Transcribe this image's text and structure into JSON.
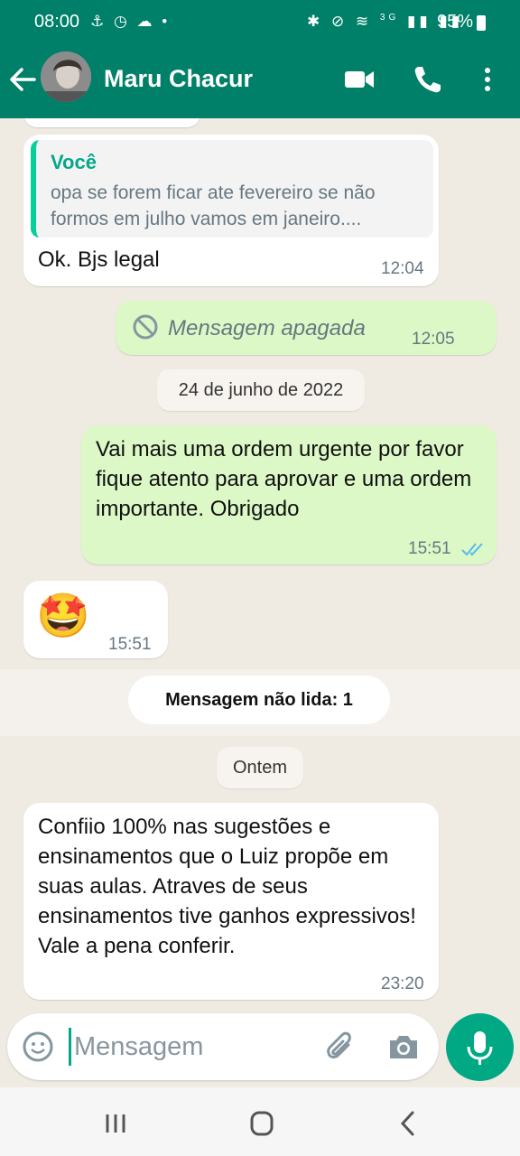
{
  "status": {
    "time": "08:00",
    "battery": "95%",
    "network": "3G"
  },
  "header": {
    "contact_name": "Maru Chacur"
  },
  "messages": [
    {
      "type": "incoming",
      "quote_author": "Você",
      "quote_text": "opa se forem ficar ate fevereiro se não formos em julho vamos em janeiro....",
      "text": "Ok. Bjs legal",
      "time": "12:04"
    },
    {
      "type": "outgoing",
      "text": "Mensagem apagada",
      "time": "12:05"
    },
    {
      "type": "outgoing",
      "text": "Vai mais uma ordem urgente por favor fique atento para aprovar e uma ordem importante. Obrigado",
      "time": "15:51"
    },
    {
      "type": "incoming",
      "emoji": "🤩",
      "time": "15:51"
    },
    {
      "type": "incoming",
      "text": "Confiio 100% nas sugestões e ensinamentos que o Luiz propõe em suas aulas. Atraves de seus ensinamentos tive ganhos expressivos! Vale a pena conferir.",
      "time": "23:20"
    }
  ],
  "dates": {
    "june": "24 de junho de 2022",
    "yesterday": "Ontem"
  },
  "unread": "Mensagem não lida: 1",
  "input": {
    "placeholder": "Mensagem"
  },
  "colors": {
    "header": "#008069",
    "outgoing_bubble": "#dcf8c6",
    "incoming_bubble": "#ffffff",
    "accent": "#00a884",
    "read_ticks": "#53bdeb"
  }
}
